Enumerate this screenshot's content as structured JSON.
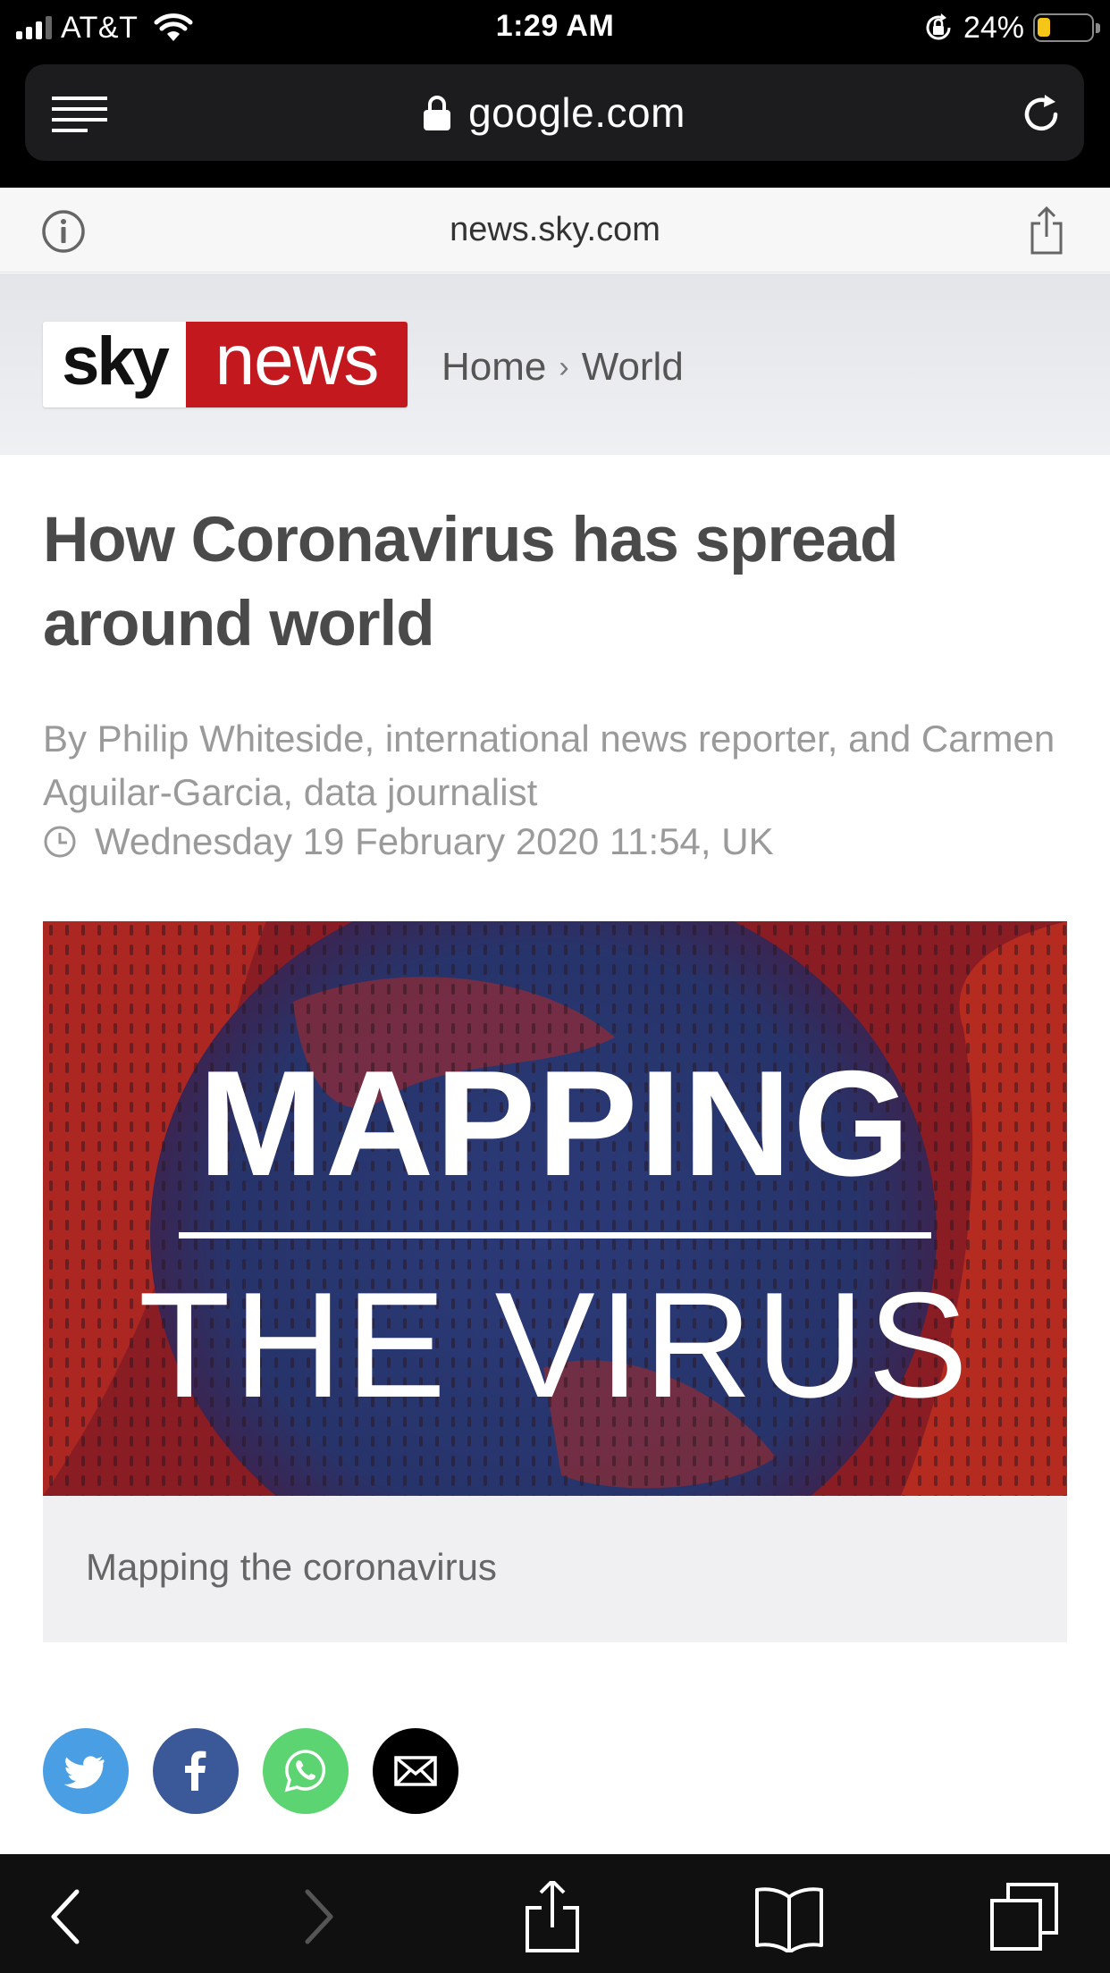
{
  "status_bar": {
    "carrier": "AT&T",
    "time": "1:29 AM",
    "battery_percent": "24%",
    "battery_level": 0.24,
    "signal_bars_active": 3,
    "signal_bars_total": 4
  },
  "browser": {
    "url": "google.com",
    "domain": "news.sky.com"
  },
  "masthead": {
    "logo_sky": "sky",
    "logo_news": "news",
    "logo_colors": {
      "news_bg": "#c4181f",
      "sky_bg": "#ffffff"
    },
    "breadcrumb": [
      "Home",
      "World"
    ],
    "breadcrumb_separator": "›"
  },
  "article": {
    "headline": "How Coronavirus has spread around world",
    "byline": "By Philip Whiteside, international news reporter, and Carmen Aguilar-Garcia, data journalist",
    "date": "Wednesday 19 February 2020 11:54, UK",
    "hero_line_1": "MAPPING",
    "hero_line_2": "THE VIRUS",
    "caption": "Mapping the coronavirus"
  },
  "share_buttons": [
    {
      "name": "twitter",
      "color": "#4a9ee4"
    },
    {
      "name": "facebook",
      "color": "#3b5998"
    },
    {
      "name": "whatsapp",
      "color": "#5cd472"
    },
    {
      "name": "email",
      "color": "#000000"
    }
  ],
  "toolbar": {
    "items": [
      "back-icon",
      "forward-icon",
      "share-icon",
      "bookmarks-icon",
      "tabs-icon"
    ],
    "forward_enabled": false
  }
}
